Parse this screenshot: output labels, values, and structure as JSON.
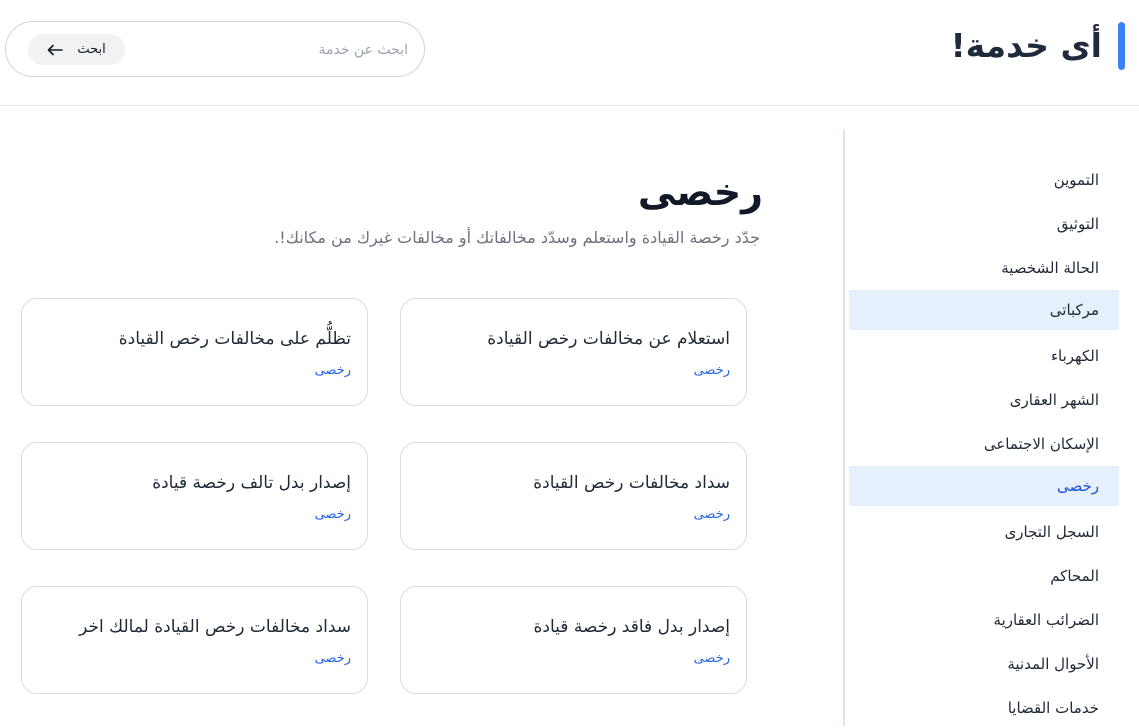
{
  "header": {
    "brand_title": "أى خدمة!",
    "search": {
      "placeholder": "ابحث عن خدمة",
      "value": "",
      "button_label": "ابحث"
    },
    "colors": {
      "accent": "#3b82f6"
    }
  },
  "sidebar": {
    "items": [
      {
        "label": "التموين",
        "state": "normal"
      },
      {
        "label": "التوثيق",
        "state": "normal"
      },
      {
        "label": "الحالة الشخصية",
        "state": "normal"
      },
      {
        "label": "مركباتى",
        "state": "highlighted"
      },
      {
        "label": "الكهرباء",
        "state": "normal"
      },
      {
        "label": "الشهر العقارى",
        "state": "normal"
      },
      {
        "label": "الإسكان الاجتماعى",
        "state": "normal"
      },
      {
        "label": "رخصى",
        "state": "selected"
      },
      {
        "label": "السجل التجارى",
        "state": "normal"
      },
      {
        "label": "المحاكم",
        "state": "normal"
      },
      {
        "label": "الضرائب العقارية",
        "state": "normal"
      },
      {
        "label": "الأحوال المدنية",
        "state": "normal"
      },
      {
        "label": "خدمات القضايا",
        "state": "normal"
      }
    ]
  },
  "main": {
    "title": "رخصى",
    "description": "جدّد رخصة القيادة واستعلم وسدّد مخالفاتك أو مخالفات غيرك من مكانك!.",
    "cards": [
      {
        "title": "استعلام عن مخالفات رخص القيادة",
        "tag": "رخصى"
      },
      {
        "title": "تظلُّم على مخالفات رخص القيادة",
        "tag": "رخصى"
      },
      {
        "title": "سداد مخالفات رخص القيادة",
        "tag": "رخصى"
      },
      {
        "title": "إصدار بدل تالف رخصة قيادة",
        "tag": "رخصى"
      },
      {
        "title": "إصدار بدل فاقد رخصة قيادة",
        "tag": "رخصى"
      },
      {
        "title": "سداد مخالفات رخص القيادة لمالك اخر",
        "tag": "رخصى"
      }
    ]
  }
}
